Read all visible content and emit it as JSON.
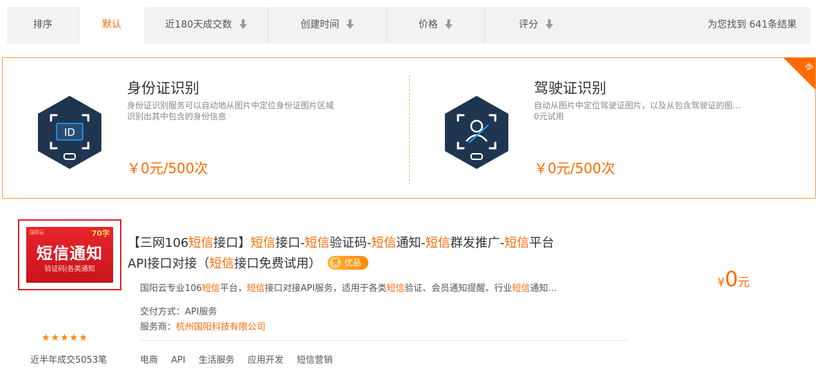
{
  "sort_bar": {
    "label": "排序",
    "items": [
      {
        "label": "默认",
        "active": true
      },
      {
        "label": "近180天成交数",
        "active": false
      },
      {
        "label": "创建时间",
        "active": false
      },
      {
        "label": "价格",
        "active": false
      },
      {
        "label": "评分",
        "active": false
      }
    ],
    "result_count": "为您找到 641条结果"
  },
  "promo": {
    "corner_badge": "荐",
    "cards": [
      {
        "title": "身份证识别",
        "desc_line1": "身份证识别服务可以自动地从图片中定位身份证图片区域",
        "desc_line2": "识别出其中包含的身份信息",
        "price": "￥0元/500次",
        "icon": "id-card-recognition-icon",
        "icon_text": "ID"
      },
      {
        "title": "驾驶证识别",
        "desc_line1": "自动从图片中定位驾驶证图片，以及从包含驾驶证的图...",
        "desc_line2": "0元试用",
        "price": "￥0元/500次",
        "icon": "driver-license-recognition-icon"
      }
    ]
  },
  "product": {
    "thumbnail": {
      "logo_text": "国阳云",
      "corner_text": "70字",
      "main_text": "短信通知",
      "sub_text": "验证码|各类通知"
    },
    "title": {
      "p1": "【三网106",
      "h1": "短信",
      "p2": "接口】",
      "h2": "短信",
      "p3": "接口-",
      "h3": "短信",
      "p4": "验证码-",
      "h4": "短信",
      "p5": "通知-",
      "h5": "短信",
      "p6": "群发推广-",
      "h6": "短信",
      "p7": "平台",
      "p8": "API接口对接（",
      "h7": "短信",
      "p9": "接口免费试用）"
    },
    "badge_icon_text": "优",
    "badge": "优品",
    "desc": {
      "p1": "国阳云专业106",
      "h1": "短信",
      "p2": "平台，",
      "h2": "短信",
      "p3": "接口对接API服务，适用于各类",
      "h3": "短信",
      "p4": "验证、会员通知提醒、行业",
      "h4": "短信",
      "p5": "通知..."
    },
    "delivery": "交付方式：API服务",
    "vendor_label": "服务商：",
    "vendor": "杭州国阳科技有限公司",
    "tags": [
      "电商",
      "API",
      "生活服务",
      "应用开发",
      "短信营销"
    ],
    "rating_stars": "★★★★★",
    "rating": 5,
    "sales": "近半年成交5053笔",
    "price_symbol": "¥",
    "price_value": "0",
    "price_unit": "元"
  },
  "colors": {
    "accent": "#ff6a00",
    "sort_bar_bg": "#f2f2f2",
    "promo_border": "#ff9a3c",
    "icon_hex": "#1f3550",
    "icon_line": "#1ea5ff",
    "thumb_red": "#e8252d",
    "thumb_border": "#d6262b"
  }
}
